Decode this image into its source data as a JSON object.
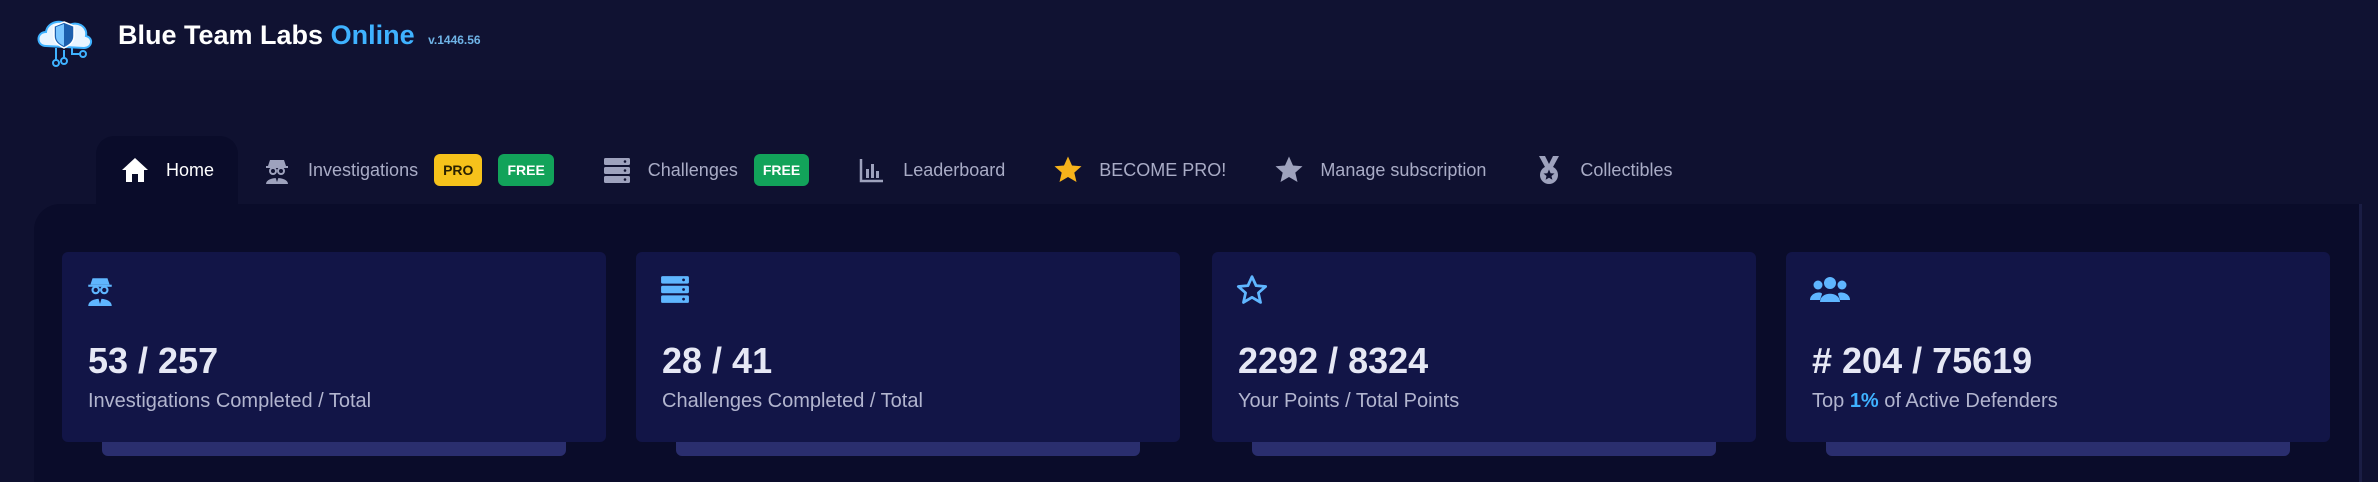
{
  "brand": {
    "name": "Blue Team Labs",
    "accent": "Online",
    "version": "v.1446.56"
  },
  "nav": {
    "home": "Home",
    "investigations": "Investigations",
    "investigations_badge_pro": "PRO",
    "investigations_badge_free": "FREE",
    "challenges": "Challenges",
    "challenges_badge_free": "FREE",
    "leaderboard": "Leaderboard",
    "become_pro": "BECOME PRO!",
    "manage_subscription": "Manage subscription",
    "collectibles": "Collectibles"
  },
  "stats": {
    "investigations": {
      "value": "53 / 257",
      "label": "Investigations Completed / Total",
      "icon": "spy-icon"
    },
    "challenges": {
      "value": "28 / 41",
      "label": "Challenges Completed / Total",
      "icon": "server-icon"
    },
    "points": {
      "value": "2292 / 8324",
      "label": "Your Points / Total Points",
      "icon": "star-outline-icon"
    },
    "rank": {
      "value": "# 204 / 75619",
      "label_prefix": "Top",
      "label_highlight": "1%",
      "label_suffix": "of Active Defenders",
      "icon": "users-icon"
    }
  },
  "colors": {
    "accent": "#3fb2ff",
    "pro_badge": "#f6c21b",
    "free_badge": "#12a35a",
    "card": "#121547",
    "background": "#0a0c2a"
  }
}
